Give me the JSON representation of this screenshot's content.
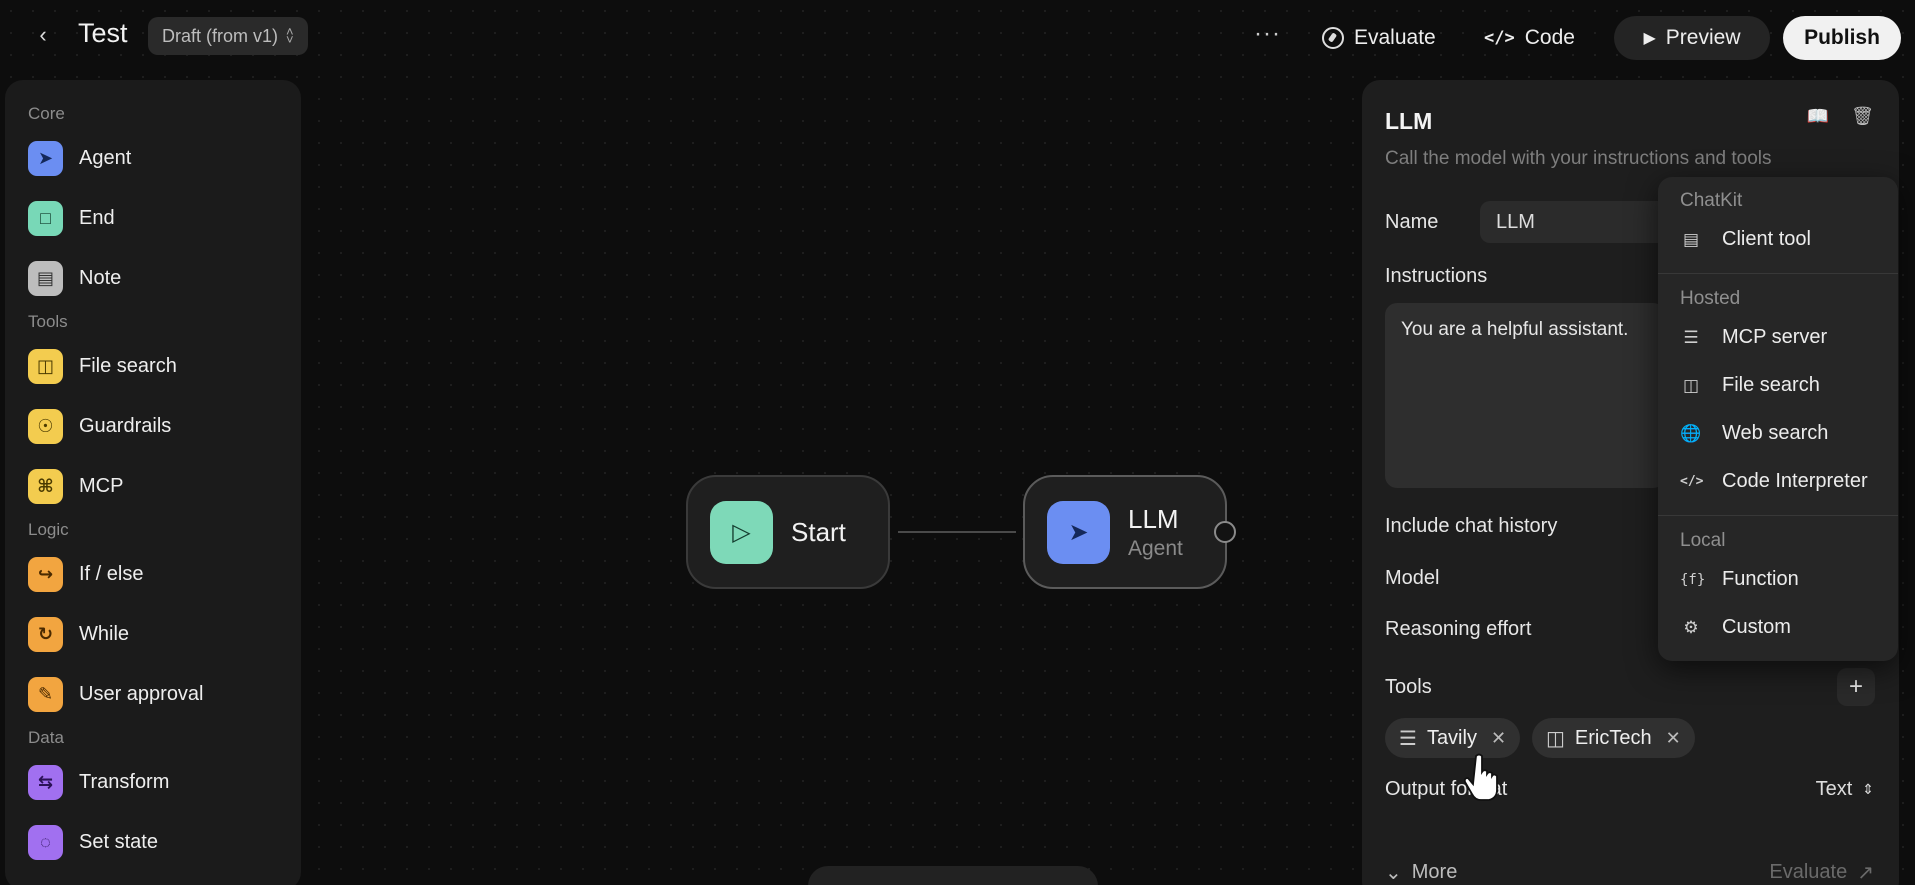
{
  "header": {
    "title": "Test",
    "draft_label": "Draft (from v1)",
    "more": "···",
    "evaluate": "Evaluate",
    "code": "Code",
    "preview": "Preview",
    "publish": "Publish"
  },
  "sidebar": {
    "sections": [
      {
        "title": "Core",
        "items": [
          "Agent",
          "End",
          "Note"
        ]
      },
      {
        "title": "Tools",
        "items": [
          "File search",
          "Guardrails",
          "MCP"
        ]
      },
      {
        "title": "Logic",
        "items": [
          "If / else",
          "While",
          "User approval"
        ]
      },
      {
        "title": "Data",
        "items": [
          "Transform",
          "Set state"
        ]
      }
    ]
  },
  "canvas": {
    "start_node": {
      "label": "Start"
    },
    "llm_node": {
      "label": "LLM",
      "subtitle": "Agent"
    }
  },
  "panel": {
    "title": "LLM",
    "description": "Call the model with your instructions and tools",
    "name_label": "Name",
    "name_value": "LLM",
    "instructions_label": "Instructions",
    "instructions_value": "You are a helpful assistant.",
    "chat_history_label": "Include chat history",
    "model_label": "Model",
    "reasoning_label": "Reasoning effort",
    "tools_label": "Tools",
    "tools": [
      "Tavily",
      "EricTech"
    ],
    "output_label": "Output format",
    "output_value": "Text",
    "more_label": "More",
    "evaluate_label": "Evaluate"
  },
  "dropdown": {
    "sections": [
      {
        "title": "ChatKit",
        "items": [
          "Client tool"
        ]
      },
      {
        "title": "Hosted",
        "items": [
          "MCP server",
          "File search",
          "Web search",
          "Code Interpreter"
        ]
      },
      {
        "title": "Local",
        "items": [
          "Function",
          "Custom"
        ]
      }
    ]
  }
}
